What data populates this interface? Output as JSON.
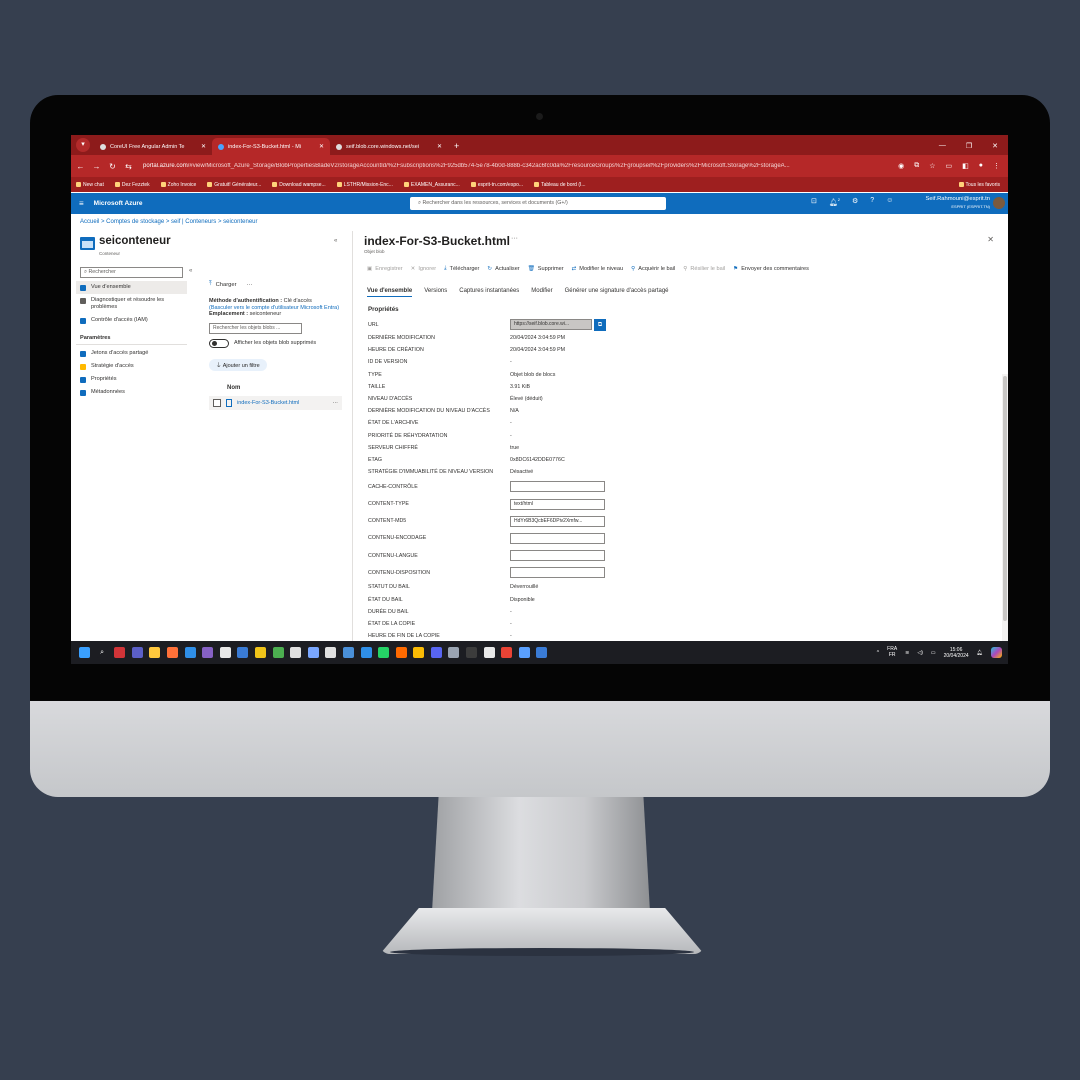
{
  "browser": {
    "tabs": [
      {
        "label": "CoreUI Free Angular Admin Te",
        "active": false
      },
      {
        "label": "index-For-S3-Bucket.html - Mi",
        "active": true
      },
      {
        "label": "seif.blob.core.windows.net/sei",
        "active": false
      }
    ],
    "url_host": "portal.azure.com",
    "url_path": "/#view/Microsoft_Azure_Storage/BlobPropertiesBladeV2/storageAccountId/%2Fsubscriptions%2F925db574-5e78-4b0d-888b-c342ac6fc0da%2FresourceGroups%2Fgroupseif%2Fproviders%2FMicrosoft.Storage%2FstorageA...",
    "bookmarks": [
      "New chat",
      "Dez Fezztek",
      "Zoho Invoice",
      "Gratuit! Générateur...",
      "Download wampse...",
      "LSTHR/Mission-Enc...",
      "EXAMEN_Assuranc...",
      "esprit-tn.com/espo...",
      "Tableau de bord (I..."
    ],
    "bookmarks_all": "Tous les favoris"
  },
  "azure": {
    "brand": "Microsoft Azure",
    "search_placeholder": "Rechercher dans les ressources, services et documents (G+/)",
    "user_name": "Seif.Rahmouni@esprit.tn",
    "user_org": "ESPRIT (ESPRIT.TN)",
    "notif_count": "2"
  },
  "breadcrumb": "Accueil > Comptes de stockage > seif | Conteneurs > seiconteneur",
  "container": {
    "title": "seiconteneur",
    "subtitle": "Conteneur",
    "menu_search": "Rechercher",
    "menu": [
      {
        "label": "Vue d'ensemble",
        "active": true,
        "color": "#0f6cbd"
      },
      {
        "label": "Diagnostiquer et résoudre les problèmes",
        "active": false,
        "color": "#605e5c"
      },
      {
        "label": "Contrôle d'accès (IAM)",
        "active": false,
        "color": "#0f6cbd"
      }
    ],
    "section": "Paramètres",
    "settings": [
      {
        "label": "Jetons d'accès partagé",
        "color": "#0f6cbd"
      },
      {
        "label": "Stratégie d'accès",
        "color": "#ffb900"
      },
      {
        "label": "Propriétés",
        "color": "#0f6cbd"
      },
      {
        "label": "Métadonnées",
        "color": "#0f6cbd"
      }
    ],
    "upload": "Charger",
    "auth_label": "Méthode d'authentification :",
    "auth_value": "Clé d'accès",
    "auth_switch": "(Basculer vers le compte d'utilisateur Microsoft Entra)",
    "location_label": "Emplacement :",
    "location_value": "seiconteneur",
    "blob_search": "Rechercher les objets blobs ...",
    "show_deleted": "Afficher les objets blob supprimés",
    "add_filter": "Ajouter un filtre",
    "col_name": "Nom",
    "blob": "index-For-S3-Bucket.html"
  },
  "blob": {
    "title": "index-For-S3-Bucket.html",
    "subtitle": "Objet blob",
    "commands": [
      {
        "label": "Enregistrer",
        "disabled": true
      },
      {
        "label": "Ignorer",
        "disabled": true
      },
      {
        "label": "Télécharger",
        "disabled": false
      },
      {
        "label": "Actualiser",
        "disabled": false
      },
      {
        "label": "Supprimer",
        "disabled": false
      },
      {
        "label": "Modifier le niveau",
        "disabled": false
      },
      {
        "label": "Acquérir le bail",
        "disabled": false
      },
      {
        "label": "Résilier le bail",
        "disabled": true
      },
      {
        "label": "Envoyer des commentaires",
        "disabled": false
      }
    ],
    "tabs": [
      "Vue d'ensemble",
      "Versions",
      "Captures instantanées",
      "Modifier",
      "Générer une signature d'accès partagé"
    ],
    "properties_title": "Propriétés",
    "url_label": "URL",
    "url_value": "https://seif.blob.core.wi...",
    "properties": [
      {
        "label": "DERNIÈRE MODIFICATION",
        "value": "20/04/2024 3:04:59 PM",
        "input": false
      },
      {
        "label": "HEURE DE CRÉATION",
        "value": "20/04/2024 3:04:59 PM",
        "input": false
      },
      {
        "label": "ID DE VERSION",
        "value": "-",
        "input": false
      },
      {
        "label": "TYPE",
        "value": "Objet blob de blocs",
        "input": false
      },
      {
        "label": "TAILLE",
        "value": "3.91 KiB",
        "input": false
      },
      {
        "label": "NIVEAU D'ACCÈS",
        "value": "Élevé (déduit)",
        "input": false
      },
      {
        "label": "DERNIÈRE MODIFICATION DU NIVEAU D'ACCÈS",
        "value": "N/A",
        "input": false
      },
      {
        "label": "ÉTAT DE L'ARCHIVE",
        "value": "-",
        "input": false
      },
      {
        "label": "PRIORITÉ DE RÉHYDRATATION",
        "value": "-",
        "input": false
      },
      {
        "label": "SERVEUR CHIFFRÉ",
        "value": "true",
        "input": false
      },
      {
        "label": "ETAG",
        "value": "0x8DC6142DDE0776C",
        "input": false
      },
      {
        "label": "STRATÉGIE D'IMMUABILITÉ DE NIVEAU VERSION",
        "value": "Désactivé",
        "input": false
      },
      {
        "label": "CACHE-CONTRÔLE",
        "value": "",
        "input": true
      },
      {
        "label": "CONTENT-TYPE",
        "value": "text/html",
        "input": true
      },
      {
        "label": "CONTENT-MD5",
        "value": "HdYr6B3QcbEF6DPiv2Xmfw...",
        "input": true
      },
      {
        "label": "CONTENU-ENCODAGE",
        "value": "",
        "input": true
      },
      {
        "label": "CONTENU-LANGUE",
        "value": "",
        "input": true
      },
      {
        "label": "CONTENU-DISPOSITION",
        "value": "",
        "input": true
      },
      {
        "label": "STATUT DU BAIL",
        "value": "Déverrouillé",
        "input": false
      },
      {
        "label": "ÉTAT DU BAIL",
        "value": "Disponible",
        "input": false
      },
      {
        "label": "DURÉE DU BAIL",
        "value": "-",
        "input": false
      },
      {
        "label": "ÉTAT DE LA COPIE",
        "value": "-",
        "input": false
      },
      {
        "label": "HEURE DE FIN DE LA COPIE",
        "value": "-",
        "input": false
      }
    ]
  },
  "taskbar": {
    "lang_top": "FRA",
    "lang_bottom": "FR",
    "time": "15:06",
    "date": "20/04/2024",
    "apps": [
      {
        "name": "start-icon",
        "color": "#3aa0ff"
      },
      {
        "name": "search-icon",
        "color": "#1c1d22"
      },
      {
        "name": "app-icon",
        "color": "#d13438"
      },
      {
        "name": "teams-icon",
        "color": "#5b5fc7"
      },
      {
        "name": "folder-icon",
        "color": "#ffc83d"
      },
      {
        "name": "firefox-icon",
        "color": "#ff7139"
      },
      {
        "name": "vscode-icon",
        "color": "#2f8fe8"
      },
      {
        "name": "visual-studio-icon",
        "color": "#8661c5"
      },
      {
        "name": "app-icon",
        "color": "#e8e8e8"
      },
      {
        "name": "app-icon",
        "color": "#3a7bd5"
      },
      {
        "name": "app-icon",
        "color": "#f0c419"
      },
      {
        "name": "app-icon",
        "color": "#4caf50"
      },
      {
        "name": "app-icon",
        "color": "#e0e0e0"
      },
      {
        "name": "app-icon",
        "color": "#7aa7ff"
      },
      {
        "name": "app-icon",
        "color": "#e0e0e0"
      },
      {
        "name": "app-icon",
        "color": "#4a90d9"
      },
      {
        "name": "app-icon",
        "color": "#2f8fe8"
      },
      {
        "name": "whatsapp-icon",
        "color": "#25d366"
      },
      {
        "name": "anaconda-icon",
        "color": "#ff6a00"
      },
      {
        "name": "chrome-icon",
        "color": "#fbbc05"
      },
      {
        "name": "discord-icon",
        "color": "#5865f2"
      },
      {
        "name": "app-icon",
        "color": "#9aa4b2"
      },
      {
        "name": "terminal-icon",
        "color": "#3c3c3c"
      },
      {
        "name": "app-icon",
        "color": "#e8e8e8"
      },
      {
        "name": "chrome-icon",
        "color": "#ea4335"
      },
      {
        "name": "notepad-icon",
        "color": "#5aa0ff"
      },
      {
        "name": "app-icon",
        "color": "#3a7bd5"
      }
    ]
  }
}
